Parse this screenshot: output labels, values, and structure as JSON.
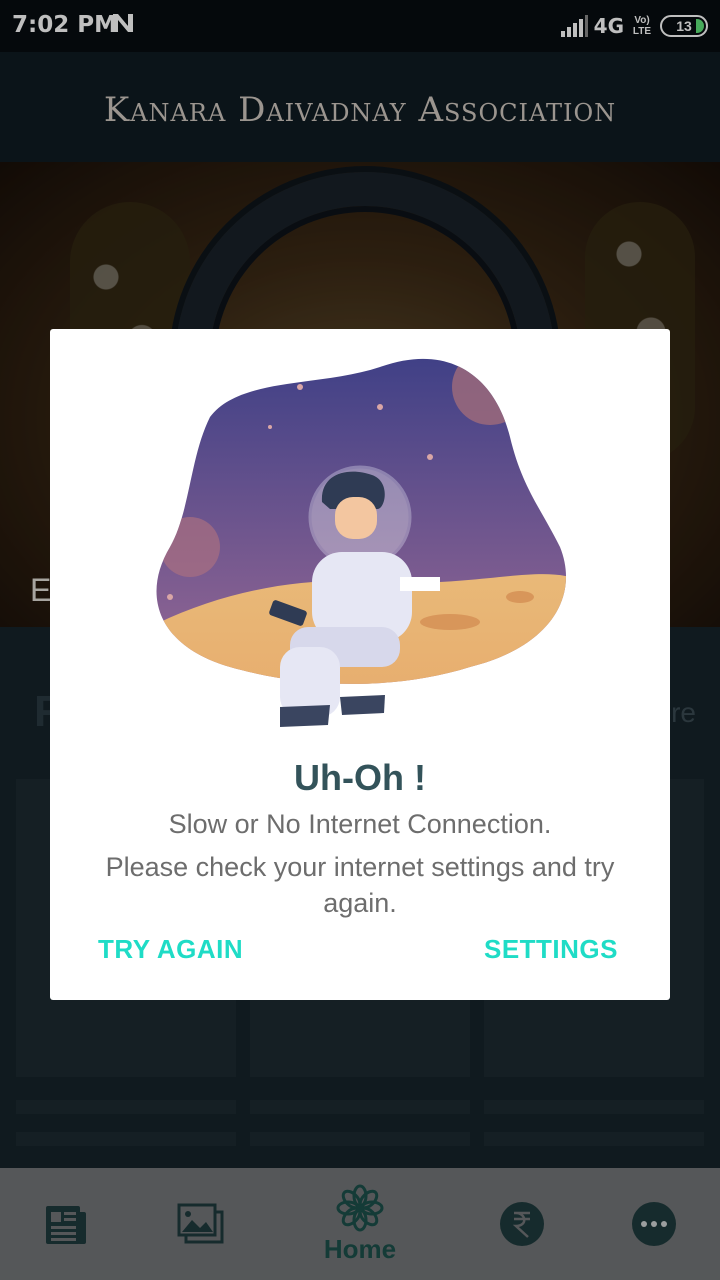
{
  "status_bar": {
    "time": "7:02 PM",
    "network": "4G",
    "volte": "Vo) LTE",
    "battery": "13"
  },
  "app": {
    "title": "Kanara Daivadnay Association"
  },
  "banner": {
    "caption": "E"
  },
  "background_section": {
    "left_heading": "F",
    "right_link": "re"
  },
  "dialog": {
    "title": "Uh-Oh !",
    "message_line1": "Slow or No Internet Connection.",
    "message_line2": "Please check your internet settings and try again.",
    "try_again_label": "TRY AGAIN",
    "settings_label": "SETTINGS"
  },
  "bottom_nav": {
    "items": [
      {
        "icon": "newspaper-icon",
        "label": ""
      },
      {
        "icon": "gallery-icon",
        "label": ""
      },
      {
        "icon": "flower-icon",
        "label": "Home"
      },
      {
        "icon": "rupee-icon",
        "label": ""
      },
      {
        "icon": "more-icon",
        "label": ""
      }
    ]
  },
  "colors": {
    "accent": "#1fdcc6",
    "title_text": "#33535a",
    "nav_active": "#1b4f4a"
  }
}
